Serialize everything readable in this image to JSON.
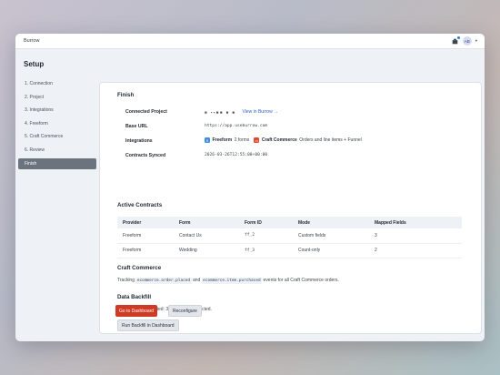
{
  "app": {
    "brand": "Burrow",
    "avatar_initials": "AB"
  },
  "page": {
    "title": "Setup"
  },
  "steps": [
    {
      "label": "1. Connection"
    },
    {
      "label": "2. Project"
    },
    {
      "label": "3. Integrations"
    },
    {
      "label": "4. Freeform"
    },
    {
      "label": "5. Craft Commerce"
    },
    {
      "label": "6. Review"
    },
    {
      "label": "Finish"
    }
  ],
  "finish": {
    "title": "Finish",
    "connected_project": {
      "label": "Connected Project",
      "masked": "■ ▪▪■■ ■ ■",
      "link": "View in Burrow →"
    },
    "base_url": {
      "label": "Base URL",
      "value": "https://app.useburrow.com"
    },
    "integrations": {
      "label": "Integrations",
      "freeform_name": "Freeform",
      "freeform_detail": "2 forms",
      "commerce_name": "Craft Commerce",
      "commerce_detail": "Orders and line items + Funnel"
    },
    "contracts_synced": {
      "label": "Contracts Synced",
      "value": "2026-03-26T12:55:08+00:00"
    }
  },
  "active_contracts": {
    "title": "Active Contracts",
    "columns": [
      "Provider",
      "Form",
      "Form ID",
      "Mode",
      "Mapped Fields"
    ],
    "rows": [
      [
        "Freeform",
        "Contact Us",
        "ff_2",
        "Custom fields",
        "3"
      ],
      [
        "Freeform",
        "Wedding",
        "ff_3",
        "Count-only",
        "2"
      ]
    ]
  },
  "craft_commerce": {
    "title": "Craft Commerce",
    "text_pre": "Tracking",
    "event1": "ecommerce.order.placed",
    "text_and": "and",
    "event2": "ecommerce.item.purchased",
    "text_post": "events for all Craft Commerce orders."
  },
  "backfill": {
    "title": "Data Backfill",
    "status": "Last backfill completed: 3 accepted, 0 rejected.",
    "run_button": "Run Backfill in Dashboard"
  },
  "actions": {
    "dashboard": "Go to Dashboard",
    "reconfigure": "Reconfigure"
  },
  "colors": {
    "primary": "#cf3a24",
    "link": "#2d63c8",
    "active_step": "#6a737e"
  }
}
